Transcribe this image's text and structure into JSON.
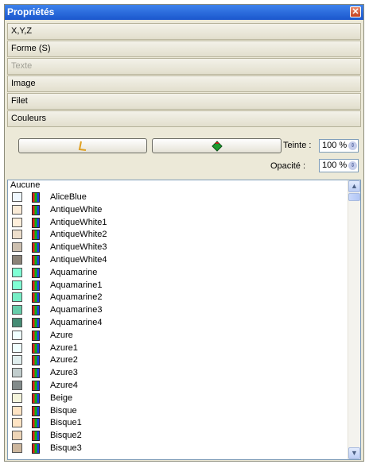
{
  "panel": {
    "title": "Propriétés",
    "close_glyph": "✕"
  },
  "sections": [
    {
      "label": "X,Y,Z",
      "disabled": false
    },
    {
      "label": "Forme (S)",
      "disabled": false
    },
    {
      "label": "Texte",
      "disabled": true
    },
    {
      "label": "Image",
      "disabled": false
    },
    {
      "label": "Filet",
      "disabled": false
    },
    {
      "label": "Couleurs",
      "disabled": false
    }
  ],
  "colour_tools": {
    "line_tool_icon": "pen-line-icon",
    "fill_tool_icon": "paint-bucket-icon",
    "tint_label": "Teinte :",
    "tint_value": "100 %",
    "opacity_label": "Opacité :",
    "opacity_value": "100 %"
  },
  "color_list": {
    "header": "Aucune",
    "items": [
      {
        "name": "AliceBlue",
        "color": "#f0f8ff"
      },
      {
        "name": "AntiqueWhite",
        "color": "#faebd7"
      },
      {
        "name": "AntiqueWhite1",
        "color": "#ffefdb"
      },
      {
        "name": "AntiqueWhite2",
        "color": "#eedfcc"
      },
      {
        "name": "AntiqueWhite3",
        "color": "#cdc0b0"
      },
      {
        "name": "AntiqueWhite4",
        "color": "#8b8378"
      },
      {
        "name": "Aquamarine",
        "color": "#7fffd4"
      },
      {
        "name": "Aquamarine1",
        "color": "#7fffd4"
      },
      {
        "name": "Aquamarine2",
        "color": "#76eec6"
      },
      {
        "name": "Aquamarine3",
        "color": "#66cdaa"
      },
      {
        "name": "Aquamarine4",
        "color": "#458b74"
      },
      {
        "name": "Azure",
        "color": "#f0ffff"
      },
      {
        "name": "Azure1",
        "color": "#f0ffff"
      },
      {
        "name": "Azure2",
        "color": "#e0eeee"
      },
      {
        "name": "Azure3",
        "color": "#c1cdcd"
      },
      {
        "name": "Azure4",
        "color": "#838b8b"
      },
      {
        "name": "Beige",
        "color": "#f5f5dc"
      },
      {
        "name": "Bisque",
        "color": "#ffe4c4"
      },
      {
        "name": "Bisque1",
        "color": "#ffe4c4"
      },
      {
        "name": "Bisque2",
        "color": "#eed5b7"
      },
      {
        "name": "Bisque3",
        "color": "#cdb79e"
      }
    ]
  },
  "scrollbar": {
    "up_glyph": "▲",
    "down_glyph": "▼"
  },
  "spin_glyph": "⇕"
}
